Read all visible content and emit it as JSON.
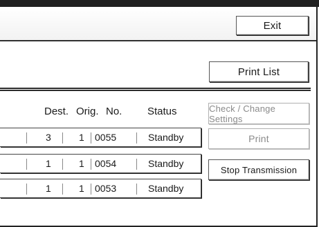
{
  "header": {
    "exit_label": "Exit"
  },
  "actions": {
    "print_list_label": "Print List",
    "check_change_label": "Check / Change Settings",
    "print_label": "Print",
    "stop_label": "Stop Transmission"
  },
  "columns": {
    "dest": "Dest.",
    "orig": "Orig.",
    "no": "No.",
    "status": "Status"
  },
  "rows": [
    {
      "dest": "3",
      "orig": "1",
      "no": "0055",
      "status": "Standby"
    },
    {
      "dest": "1",
      "orig": "1",
      "no": "0054",
      "status": "Standby"
    },
    {
      "dest": "1",
      "orig": "1",
      "no": "0053",
      "status": "Standby"
    }
  ],
  "colors": {
    "frame": "#222222",
    "disabled_text": "#8a8a8a"
  }
}
